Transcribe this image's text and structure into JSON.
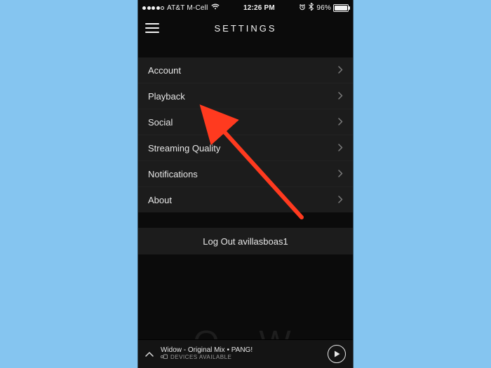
{
  "status": {
    "carrier": "AT&T M-Cell",
    "time": "12:26 PM",
    "battery_pct": "96%"
  },
  "header": {
    "title": "SETTINGS"
  },
  "settings": {
    "items": [
      {
        "label": "Account"
      },
      {
        "label": "Playback"
      },
      {
        "label": "Social"
      },
      {
        "label": "Streaming Quality"
      },
      {
        "label": "Notifications"
      },
      {
        "label": "About"
      }
    ]
  },
  "logout": {
    "label": "Log Out avillasboas1"
  },
  "now_playing": {
    "title_line": "Widow - Original Mix • PANG!",
    "devices_label": "DEVICES AVAILABLE"
  }
}
